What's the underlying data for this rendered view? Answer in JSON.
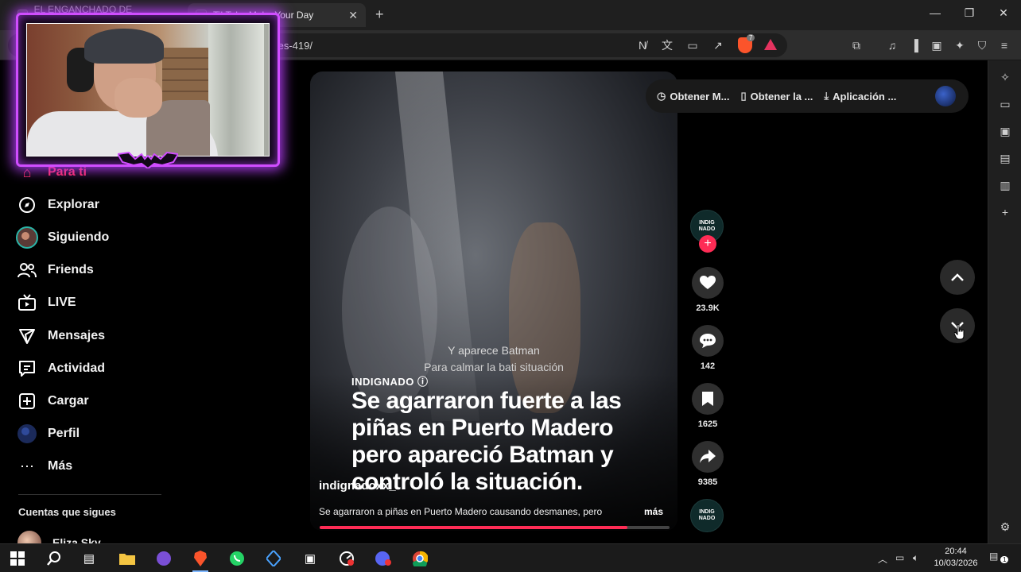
{
  "browser": {
    "tabs": [
      {
        "title": "EL ENGANCHADO DE REGGAETON",
        "active": false
      },
      {
        "title": "TikTok - Make Your Day",
        "active": true
      }
    ],
    "url": "/es-419/",
    "new_tab_symbol": "+",
    "window_controls": [
      "—",
      "❐",
      "✕"
    ]
  },
  "sidebar": {
    "items": [
      {
        "label": "Para ti",
        "icon": "home-icon"
      },
      {
        "label": "Explorar",
        "icon": "compass-icon"
      },
      {
        "label": "Siguiendo",
        "icon": "following-avatar-icon"
      },
      {
        "label": "Friends",
        "icon": "friends-icon"
      },
      {
        "label": "LIVE",
        "icon": "live-tv-icon"
      },
      {
        "label": "Mensajes",
        "icon": "send-icon"
      },
      {
        "label": "Actividad",
        "icon": "activity-icon"
      },
      {
        "label": "Cargar",
        "icon": "upload-icon"
      },
      {
        "label": "Perfil",
        "icon": "profile-avatar-icon"
      },
      {
        "label": "Más",
        "icon": "more-dots-icon"
      }
    ],
    "followed_title": "Cuentas que sigues",
    "followed_accounts": [
      {
        "name": "Eliza Sky"
      }
    ]
  },
  "getapp": {
    "items": [
      "Obtener M...",
      "Obtener la ...",
      "Aplicación ..."
    ]
  },
  "video": {
    "subtitle_line1": "Y aparece Batman",
    "subtitle_line2": "Para calmar la bati situación",
    "brand": "INDIGNADO ⓘ",
    "headline": "Se agarraron fuerte a las piñas en Puerto Madero pero apareció Batman y controló la situación.",
    "author": "indignadoxx_",
    "description": "Se agarraron a piñas en Puerto Madero causando desmanes, pero",
    "more_label": "más",
    "progress": 0.88
  },
  "actions": {
    "avatar_text": "INDIG NADO",
    "likes": "23.9K",
    "comments": "142",
    "saves": "1625",
    "shares": "9385",
    "follow_symbol": "+"
  },
  "taskbar": {
    "time": "20:44",
    "date": "10/03/2026",
    "notification_count": "1"
  },
  "colors": {
    "accent": "#fe2c55",
    "webcam_glow": "#d04dff"
  }
}
